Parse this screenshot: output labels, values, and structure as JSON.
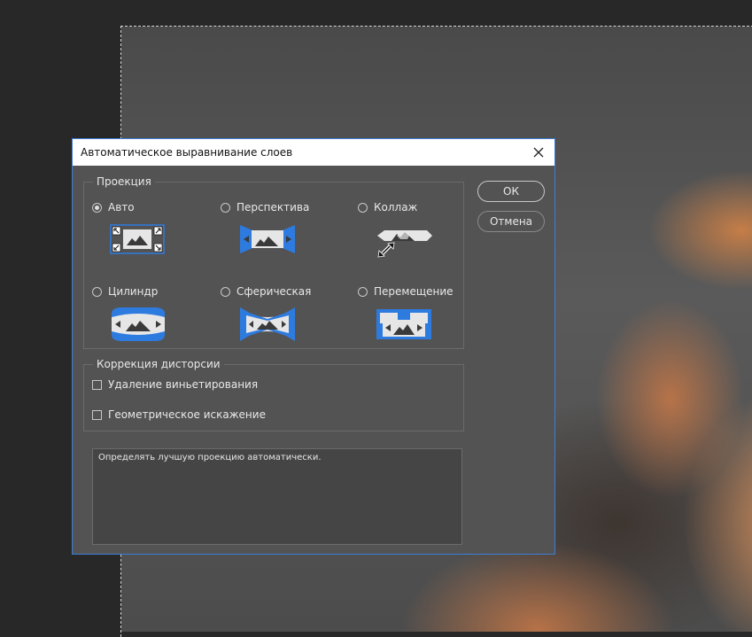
{
  "dialog": {
    "title": "Автоматическое выравнивание слоев",
    "projection": {
      "legend": "Проекция",
      "options": [
        {
          "label": "Авто",
          "selected": true,
          "icon": "auto-projection-icon"
        },
        {
          "label": "Перспектива",
          "selected": false,
          "icon": "perspective-projection-icon"
        },
        {
          "label": "Коллаж",
          "selected": false,
          "icon": "collage-projection-icon"
        },
        {
          "label": "Цилиндр",
          "selected": false,
          "icon": "cylinder-projection-icon"
        },
        {
          "label": "Сферическая",
          "selected": false,
          "icon": "spherical-projection-icon"
        },
        {
          "label": "Перемещение",
          "selected": false,
          "icon": "reposition-projection-icon"
        }
      ]
    },
    "distortion": {
      "legend": "Коррекция дисторсии",
      "options": [
        {
          "label": "Удаление виньетирования",
          "checked": false
        },
        {
          "label": "Геометрическое искажение",
          "checked": false
        }
      ]
    },
    "buttons": {
      "ok": "ОК",
      "cancel": "Отмена"
    },
    "description": "Определять лучшую проекцию автоматически."
  },
  "colors": {
    "accent_blue": "#2e7be0",
    "dialog_bg": "#535353",
    "icon_light": "#e6e6e6"
  }
}
